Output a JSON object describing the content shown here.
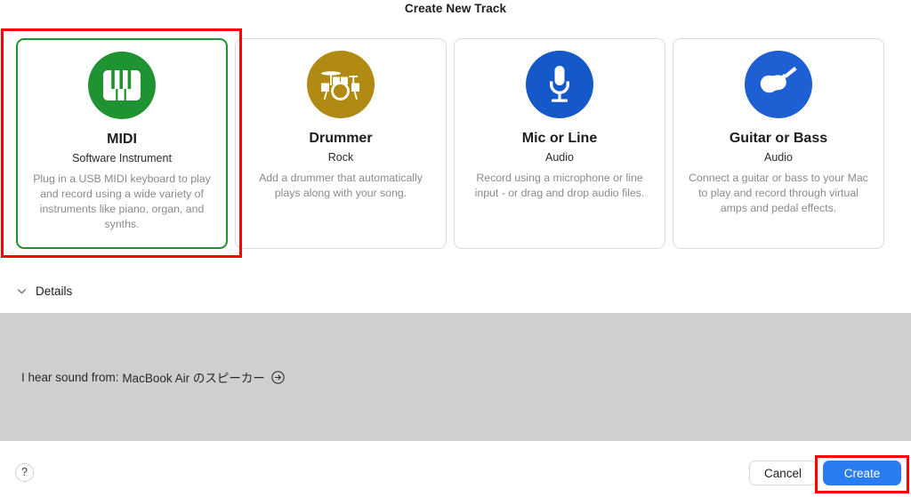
{
  "dialog": {
    "title": "Create New Track"
  },
  "cards": [
    {
      "id": "midi",
      "title": "MIDI",
      "subtitle": "Software Instrument",
      "description": "Plug in a USB MIDI keyboard to play and record using a wide variety of instruments like piano, organ, and synths.",
      "icon": "piano-keyboard-icon",
      "icon_bg": "#1f9231",
      "selected": true
    },
    {
      "id": "drummer",
      "title": "Drummer",
      "subtitle": "Rock",
      "description": "Add a drummer that automatically plays along with your song.",
      "icon": "drum-kit-icon",
      "icon_bg": "#b08a12",
      "selected": false
    },
    {
      "id": "mic-or-line",
      "title": "Mic or Line",
      "subtitle": "Audio",
      "description": "Record using a microphone or line input - or drag and drop audio files.",
      "icon": "microphone-icon",
      "icon_bg": "#1559c8",
      "selected": false
    },
    {
      "id": "guitar-or-bass",
      "title": "Guitar or Bass",
      "subtitle": "Audio",
      "description": "Connect a guitar or bass to your Mac to play and record through virtual amps and pedal effects.",
      "icon": "guitar-icon",
      "icon_bg": "#1f5fd4",
      "selected": false
    }
  ],
  "details": {
    "label": "Details",
    "disclosure_icon": "chevron-down-icon",
    "expanded": true,
    "sound_source": {
      "label": "I hear sound from: ",
      "value": "MacBook Air のスピーカー",
      "action_icon": "arrow-right-circle-icon"
    }
  },
  "footer": {
    "help_label": "?",
    "cancel_label": "Cancel",
    "create_label": "Create"
  },
  "annotations": {
    "selection_color": "#ff0000",
    "selected_card_color": "#1f9231",
    "accent_color": "#2b7cf0",
    "panel_color": "#cfcfcf"
  }
}
